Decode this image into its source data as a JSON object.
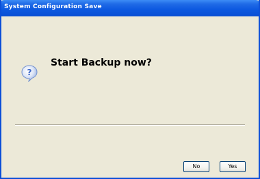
{
  "window": {
    "title": "System Configuration Save"
  },
  "dialog": {
    "icon": "question-icon",
    "message": "Start Backup now?"
  },
  "buttons": {
    "no_label": "No",
    "yes_label": "Yes"
  },
  "colors": {
    "titlebar": "#0a4fd3",
    "dialog_bg": "#ece9d8",
    "button_border": "#003c74",
    "icon_blue": "#3a66c8"
  }
}
